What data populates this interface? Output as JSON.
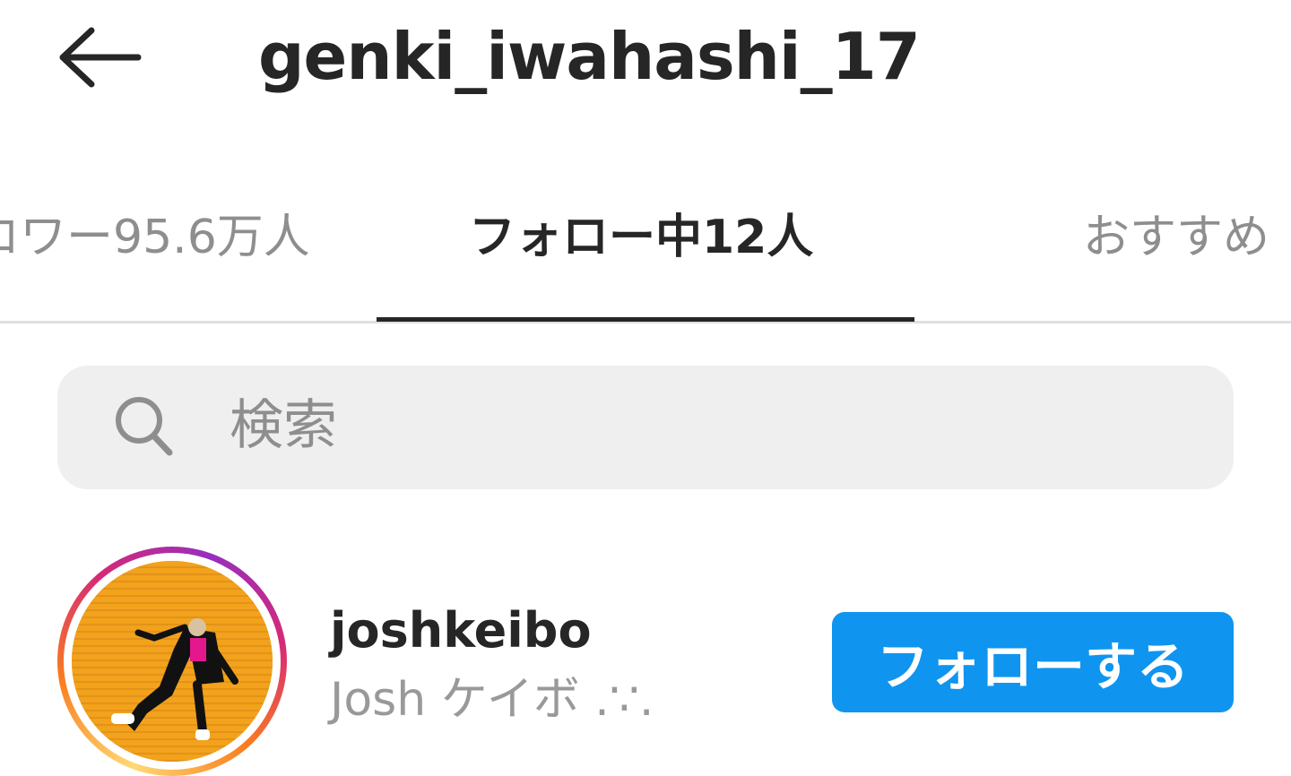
{
  "header": {
    "back_icon": "arrow-left-icon",
    "title": "genki_iwahashi_17"
  },
  "tabs": [
    {
      "label": "ロワー95.6万人",
      "active": false
    },
    {
      "label": "フォロー中12人",
      "active": true
    },
    {
      "label": "おすすめ",
      "active": false
    }
  ],
  "search": {
    "icon": "search-icon",
    "placeholder": "検索"
  },
  "users": [
    {
      "username": "joshkeibo",
      "full_name": "Josh ケイボ .∵.",
      "button_label": "フォローする",
      "has_story_ring": true
    }
  ],
  "colors": {
    "follow_button": "#0f95f0",
    "active_text": "#262626",
    "inactive_text": "#8e8e8e",
    "search_bg": "#efefef"
  }
}
